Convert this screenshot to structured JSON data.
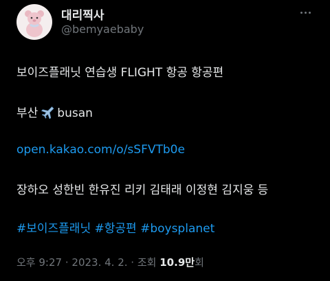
{
  "author": {
    "display_name": "대리찍사",
    "handle": "@bemyaebaby",
    "avatar_icon": "pink-teddy-bear-avatar"
  },
  "more_icon": "more-horizontal-icon",
  "tweet": {
    "line1": "보이즈플래닛 연습생 FLIGHT 항공 항공편",
    "line2_prefix": "부산",
    "line2_emoji": "airplane-icon",
    "line2_suffix": "busan",
    "link": "open.kakao.com/o/sSFVTb0e",
    "names": "장하오 성한빈 한유진 리키 김태래 이정현 김지웅 등",
    "hashtags": [
      "#보이즈플래닛",
      "#항공편",
      "#boysplanet"
    ]
  },
  "meta": {
    "time": "오후 9:27",
    "separator": "·",
    "date": "2023. 4. 2.",
    "views_label": "조회",
    "views_count": "10.9만",
    "views_suffix": "회"
  },
  "colors": {
    "background": "#000000",
    "text": "#e7e9ea",
    "secondary": "#71767b",
    "link": "#1d9bf0"
  }
}
